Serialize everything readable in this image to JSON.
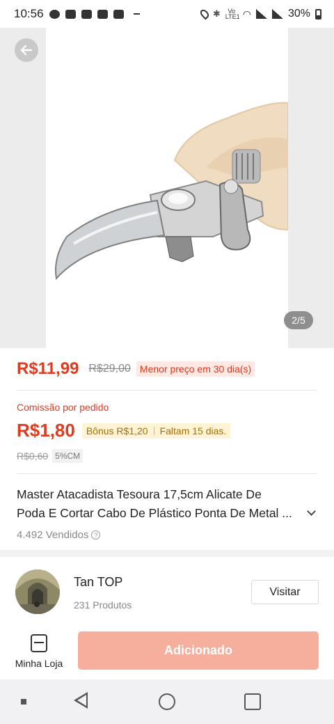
{
  "status_bar": {
    "time": "10:56",
    "battery": "30%",
    "lte_label": "Vo LTE1"
  },
  "gallery": {
    "page_indicator": "2/5"
  },
  "price": {
    "current": "R$11,99",
    "original": "R$29,00",
    "badge": "Menor preço em 30 dia(s)"
  },
  "commission": {
    "label": "Comissão por pedido",
    "value": "R$1,80",
    "bonus": "Bônus R$1,20",
    "remaining": "Faltam 15 dias.",
    "old_value": "R$0,60",
    "rate": "5%CM"
  },
  "product": {
    "title_line1": "Master Atacadista Tesoura 17,5cm Alicate De",
    "title_line2": "Poda E Cortar Cabo De Plástico Ponta De Metal ...",
    "sold": "4.492 Vendidos"
  },
  "shop": {
    "name": "Tan TOP",
    "products": "231 Produtos",
    "visit_label": "Visitar"
  },
  "actions": {
    "my_shop_label": "Minha Loja",
    "add_label": "Adicionado"
  },
  "colors": {
    "accent": "#e03a1f",
    "add_button": "#f6ae9d",
    "bonus_bg": "#fdf3d5"
  }
}
